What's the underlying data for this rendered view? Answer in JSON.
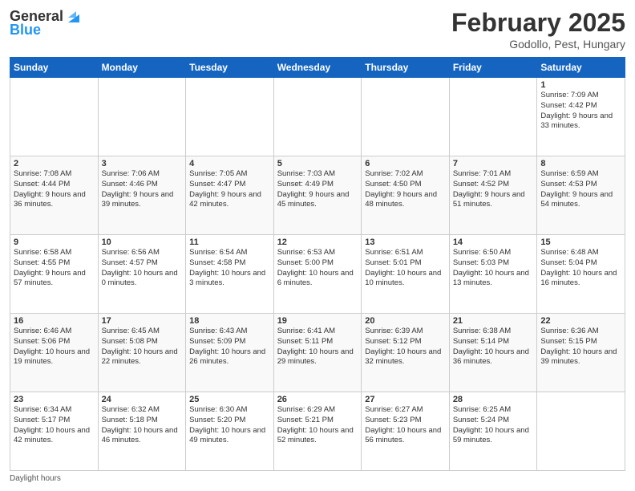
{
  "header": {
    "logo_line1": "General",
    "logo_line2": "Blue",
    "month_year": "February 2025",
    "location": "Godollo, Pest, Hungary"
  },
  "days_of_week": [
    "Sunday",
    "Monday",
    "Tuesday",
    "Wednesday",
    "Thursday",
    "Friday",
    "Saturday"
  ],
  "weeks": [
    [
      {
        "day": "",
        "info": ""
      },
      {
        "day": "",
        "info": ""
      },
      {
        "day": "",
        "info": ""
      },
      {
        "day": "",
        "info": ""
      },
      {
        "day": "",
        "info": ""
      },
      {
        "day": "",
        "info": ""
      },
      {
        "day": "1",
        "info": "Sunrise: 7:09 AM\nSunset: 4:42 PM\nDaylight: 9 hours and 33 minutes."
      }
    ],
    [
      {
        "day": "2",
        "info": "Sunrise: 7:08 AM\nSunset: 4:44 PM\nDaylight: 9 hours and 36 minutes."
      },
      {
        "day": "3",
        "info": "Sunrise: 7:06 AM\nSunset: 4:46 PM\nDaylight: 9 hours and 39 minutes."
      },
      {
        "day": "4",
        "info": "Sunrise: 7:05 AM\nSunset: 4:47 PM\nDaylight: 9 hours and 42 minutes."
      },
      {
        "day": "5",
        "info": "Sunrise: 7:03 AM\nSunset: 4:49 PM\nDaylight: 9 hours and 45 minutes."
      },
      {
        "day": "6",
        "info": "Sunrise: 7:02 AM\nSunset: 4:50 PM\nDaylight: 9 hours and 48 minutes."
      },
      {
        "day": "7",
        "info": "Sunrise: 7:01 AM\nSunset: 4:52 PM\nDaylight: 9 hours and 51 minutes."
      },
      {
        "day": "8",
        "info": "Sunrise: 6:59 AM\nSunset: 4:53 PM\nDaylight: 9 hours and 54 minutes."
      }
    ],
    [
      {
        "day": "9",
        "info": "Sunrise: 6:58 AM\nSunset: 4:55 PM\nDaylight: 9 hours and 57 minutes."
      },
      {
        "day": "10",
        "info": "Sunrise: 6:56 AM\nSunset: 4:57 PM\nDaylight: 10 hours and 0 minutes."
      },
      {
        "day": "11",
        "info": "Sunrise: 6:54 AM\nSunset: 4:58 PM\nDaylight: 10 hours and 3 minutes."
      },
      {
        "day": "12",
        "info": "Sunrise: 6:53 AM\nSunset: 5:00 PM\nDaylight: 10 hours and 6 minutes."
      },
      {
        "day": "13",
        "info": "Sunrise: 6:51 AM\nSunset: 5:01 PM\nDaylight: 10 hours and 10 minutes."
      },
      {
        "day": "14",
        "info": "Sunrise: 6:50 AM\nSunset: 5:03 PM\nDaylight: 10 hours and 13 minutes."
      },
      {
        "day": "15",
        "info": "Sunrise: 6:48 AM\nSunset: 5:04 PM\nDaylight: 10 hours and 16 minutes."
      }
    ],
    [
      {
        "day": "16",
        "info": "Sunrise: 6:46 AM\nSunset: 5:06 PM\nDaylight: 10 hours and 19 minutes."
      },
      {
        "day": "17",
        "info": "Sunrise: 6:45 AM\nSunset: 5:08 PM\nDaylight: 10 hours and 22 minutes."
      },
      {
        "day": "18",
        "info": "Sunrise: 6:43 AM\nSunset: 5:09 PM\nDaylight: 10 hours and 26 minutes."
      },
      {
        "day": "19",
        "info": "Sunrise: 6:41 AM\nSunset: 5:11 PM\nDaylight: 10 hours and 29 minutes."
      },
      {
        "day": "20",
        "info": "Sunrise: 6:39 AM\nSunset: 5:12 PM\nDaylight: 10 hours and 32 minutes."
      },
      {
        "day": "21",
        "info": "Sunrise: 6:38 AM\nSunset: 5:14 PM\nDaylight: 10 hours and 36 minutes."
      },
      {
        "day": "22",
        "info": "Sunrise: 6:36 AM\nSunset: 5:15 PM\nDaylight: 10 hours and 39 minutes."
      }
    ],
    [
      {
        "day": "23",
        "info": "Sunrise: 6:34 AM\nSunset: 5:17 PM\nDaylight: 10 hours and 42 minutes."
      },
      {
        "day": "24",
        "info": "Sunrise: 6:32 AM\nSunset: 5:18 PM\nDaylight: 10 hours and 46 minutes."
      },
      {
        "day": "25",
        "info": "Sunrise: 6:30 AM\nSunset: 5:20 PM\nDaylight: 10 hours and 49 minutes."
      },
      {
        "day": "26",
        "info": "Sunrise: 6:29 AM\nSunset: 5:21 PM\nDaylight: 10 hours and 52 minutes."
      },
      {
        "day": "27",
        "info": "Sunrise: 6:27 AM\nSunset: 5:23 PM\nDaylight: 10 hours and 56 minutes."
      },
      {
        "day": "28",
        "info": "Sunrise: 6:25 AM\nSunset: 5:24 PM\nDaylight: 10 hours and 59 minutes."
      },
      {
        "day": "",
        "info": ""
      }
    ]
  ],
  "footer": {
    "daylight_label": "Daylight hours"
  }
}
